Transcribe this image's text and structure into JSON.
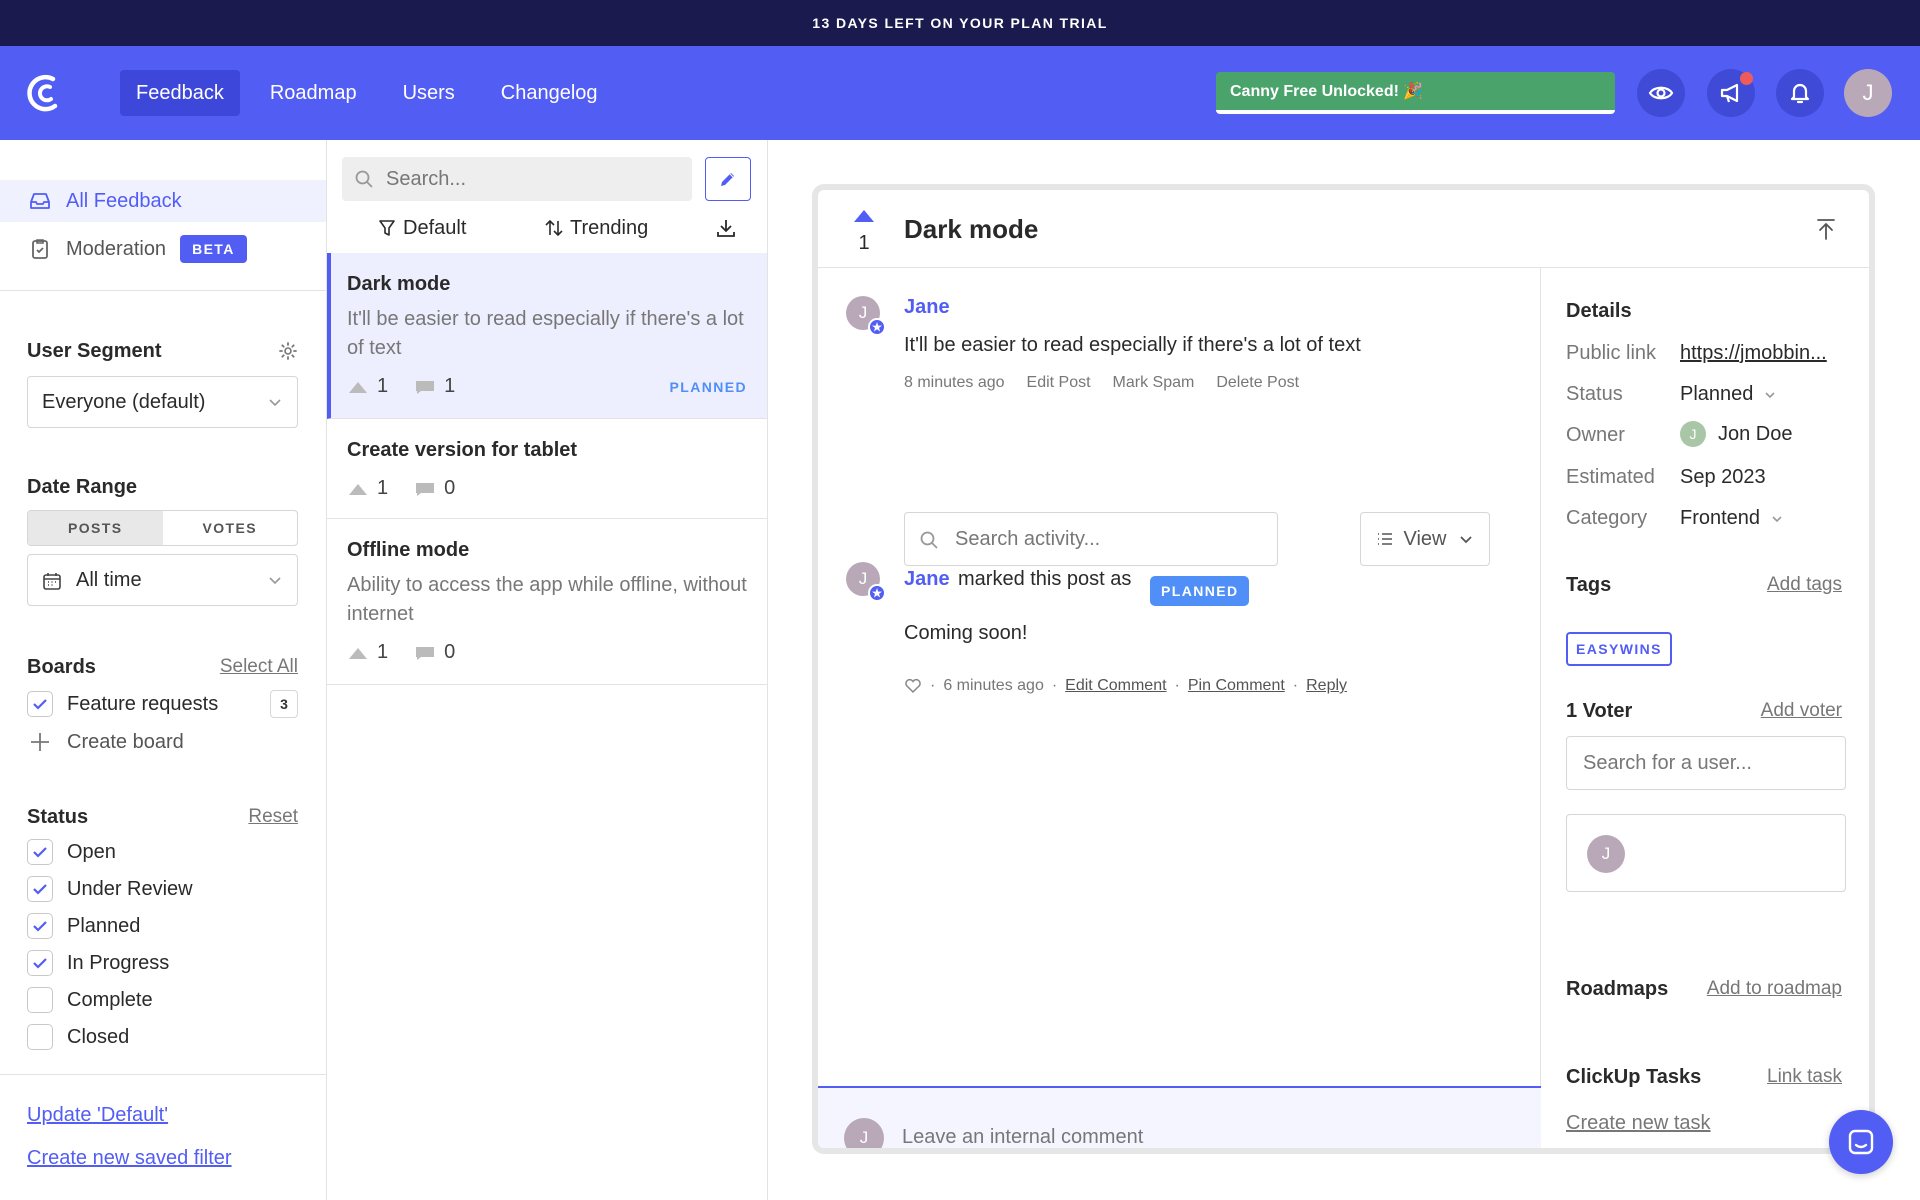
{
  "banner": {
    "text": "13 DAYS LEFT ON YOUR PLAN TRIAL"
  },
  "header": {
    "logo_icon": "canny-logo-icon",
    "nav": [
      {
        "label": "Feedback",
        "active": true
      },
      {
        "label": "Roadmap",
        "active": false
      },
      {
        "label": "Users",
        "active": false
      },
      {
        "label": "Changelog",
        "active": false
      }
    ],
    "unlock_label": "Canny Free Unlocked! 🎉",
    "icons": [
      "eye-icon",
      "megaphone-icon",
      "bell-icon"
    ],
    "avatar_initial": "J"
  },
  "sidebar": {
    "links": [
      {
        "label": "All Feedback",
        "icon": "inbox-icon",
        "active": true
      },
      {
        "label": "Moderation",
        "icon": "clipboard-icon",
        "badge": "BETA"
      }
    ],
    "user_segment": {
      "title": "User Segment",
      "value": "Everyone (default)"
    },
    "date_range": {
      "title": "Date Range",
      "tabs": [
        "POSTS",
        "VOTES"
      ],
      "active_tab": "POSTS",
      "value": "All time"
    },
    "boards": {
      "title": "Boards",
      "select_all": "Select All",
      "items": [
        {
          "label": "Feature requests",
          "count": "3",
          "checked": true
        }
      ],
      "create": "Create board"
    },
    "status": {
      "title": "Status",
      "reset": "Reset",
      "items": [
        {
          "label": "Open",
          "checked": true
        },
        {
          "label": "Under Review",
          "checked": true
        },
        {
          "label": "Planned",
          "checked": true
        },
        {
          "label": "In Progress",
          "checked": true
        },
        {
          "label": "Complete",
          "checked": false
        },
        {
          "label": "Closed",
          "checked": false
        }
      ]
    },
    "update_filter": "Update 'Default'",
    "create_filter": "Create new saved filter"
  },
  "list": {
    "search_placeholder": "Search...",
    "sort_default": "Default",
    "sort_trending": "Trending",
    "posts": [
      {
        "title": "Dark mode",
        "desc": "It'll be easier to read especially if there's a lot of text",
        "votes": "1",
        "comments": "1",
        "status": "PLANNED"
      },
      {
        "title": "Create version for tablet",
        "desc": "",
        "votes": "1",
        "comments": "0",
        "status": ""
      },
      {
        "title": "Offline mode",
        "desc": "Ability to access the app while offline, without internet",
        "votes": "1",
        "comments": "0",
        "status": ""
      }
    ]
  },
  "detail": {
    "votes": "1",
    "title": "Dark mode",
    "post": {
      "author": "Jane",
      "author_initial": "J",
      "body": "It'll be easier to read especially if there's a lot of text",
      "time": "8 minutes ago",
      "actions": [
        "Edit Post",
        "Mark Spam",
        "Delete Post"
      ]
    },
    "activity_search_placeholder": "Search activity...",
    "view_label": "View",
    "activity": {
      "author": "Jane",
      "text": "marked this post as",
      "status": "PLANNED",
      "comment": "Coming soon!",
      "time": "6 minutes ago",
      "actions": [
        "Edit Comment",
        "Pin Comment",
        "Reply"
      ]
    },
    "internal_placeholder": "Leave an internal comment",
    "side": {
      "details_title": "Details",
      "public_link_label": "Public link",
      "public_link_value": "https://jmobbin...",
      "status_label": "Status",
      "status_value": "Planned",
      "owner_label": "Owner",
      "owner_value": "Jon Doe",
      "owner_initial": "J",
      "estimated_label": "Estimated",
      "estimated_value": "Sep 2023",
      "category_label": "Category",
      "category_value": "Frontend",
      "tags_title": "Tags",
      "add_tags": "Add tags",
      "tag": "EASYWINS",
      "voter_title": "1 Voter",
      "add_voter": "Add voter",
      "voter_search_placeholder": "Search for a user...",
      "voter_initial": "J",
      "roadmaps_title": "Roadmaps",
      "add_roadmap": "Add to roadmap",
      "clickup_title": "ClickUp Tasks",
      "link_task": "Link task",
      "create_task": "Create new task"
    }
  },
  "colors": {
    "accent": "#525df4",
    "banner": "#1a1a4e",
    "planned": "#4f8ff7",
    "unlock": "#4aa36a"
  }
}
